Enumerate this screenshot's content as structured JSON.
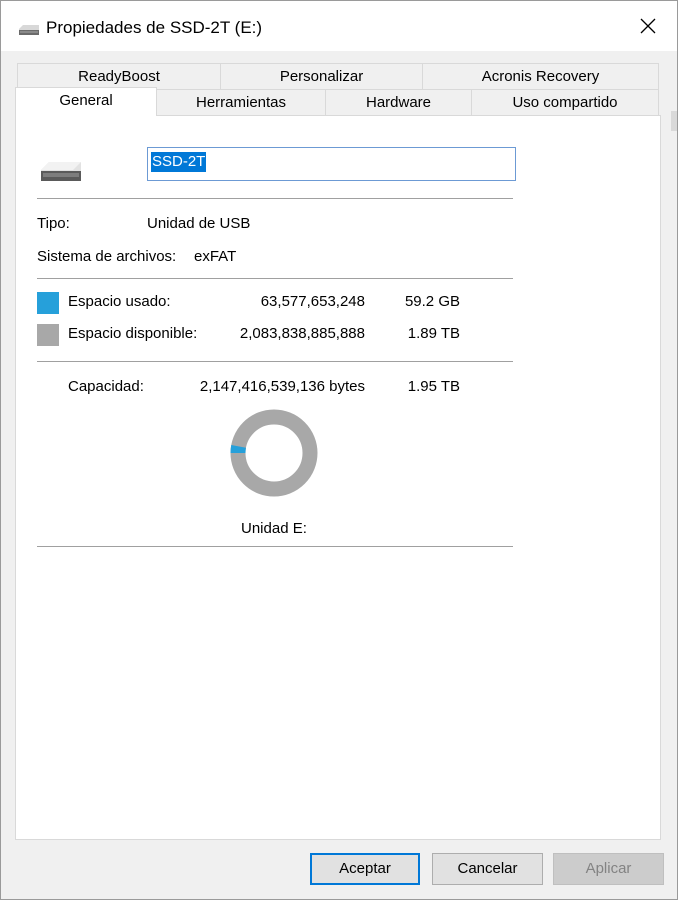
{
  "window": {
    "title": "Propiedades de SSD-2T (E:)"
  },
  "tabs": {
    "row1": [
      "ReadyBoost",
      "Personalizar",
      "Acronis Recovery"
    ],
    "row2": [
      "General",
      "Herramientas",
      "Hardware",
      "Uso compartido"
    ],
    "active": "General"
  },
  "general": {
    "name_value": "SSD-2T",
    "type_label": "Tipo:",
    "type_value": "Unidad de USB",
    "fs_label": "Sistema de archivos:",
    "fs_value": "exFAT",
    "used_label": "Espacio usado:",
    "used_bytes": "63,577,653,248",
    "used_size": "59.2 GB",
    "free_label": "Espacio disponible:",
    "free_bytes": "2,083,838,885,888",
    "free_size": "1.89 TB",
    "capacity_label": "Capacidad:",
    "capacity_bytes": "2,147,416,539,136 bytes",
    "capacity_size": "1.95 TB",
    "drive_label": "Unidad E:",
    "used_fraction": 0.0296
  },
  "colors": {
    "used": "#26a0da",
    "free": "#a8a8a8",
    "accent": "#0078d7"
  },
  "buttons": {
    "ok": "Aceptar",
    "cancel": "Cancelar",
    "apply": "Aplicar"
  },
  "icons": {
    "title": "drive-icon",
    "close": "close-icon",
    "drive": "usb-drive-icon"
  }
}
